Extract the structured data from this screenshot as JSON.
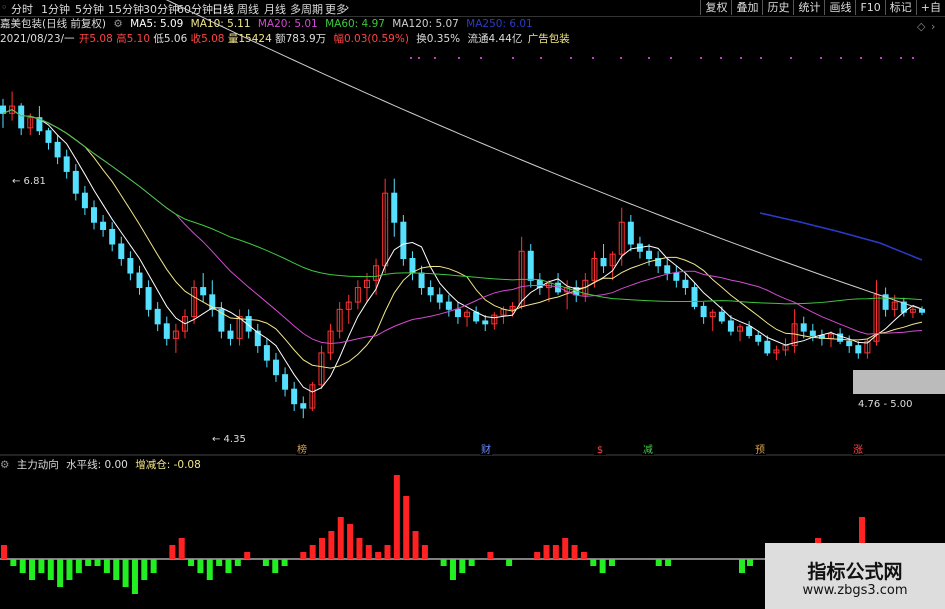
{
  "toolbar": {
    "periods": [
      {
        "label": "分时",
        "x": 11
      },
      {
        "label": "1分钟",
        "x": 41
      },
      {
        "label": "5分钟",
        "x": 75
      },
      {
        "label": "15分钟",
        "x": 108
      },
      {
        "label": "30分钟",
        "x": 143
      },
      {
        "label": "60分钟",
        "x": 177
      },
      {
        "label": "日线",
        "x": 212
      },
      {
        "label": "周线",
        "x": 237
      },
      {
        "label": "月线",
        "x": 264
      },
      {
        "label": "多周期",
        "x": 290
      },
      {
        "label": "更多",
        "x": 325
      }
    ],
    "more_arrow": "›",
    "tools": [
      "复权",
      "叠加",
      "历史",
      "统计",
      "画线",
      "F10",
      "标记",
      "+自"
    ]
  },
  "main_legend": {
    "stock_name": "嘉美包装(日线 前复权)",
    "ma5": "MA5: 5.09",
    "ma10": "MA10: 5.11",
    "ma20": "MA20: 5.01",
    "ma60": "MA60: 4.97",
    "ma120": "MA120: 5.07",
    "ma250": "MA250: 6.01"
  },
  "info_row": {
    "date": "2021/08/23/一",
    "open": "开5.08",
    "high": "高5.10",
    "low": "低5.06",
    "close": "收5.08",
    "volume": "量15424",
    "amount": "额783.9万",
    "change": "幅0.03(0.59%)",
    "turnover": "换0.35%",
    "float": "流通4.44亿",
    "sector": "广告包装"
  },
  "price_labels": {
    "high_mark": "6.81",
    "low_mark": "4.35",
    "range": "4.76 - 5.00"
  },
  "event_markers": [
    {
      "label": "榜",
      "x": 302,
      "color": "#d4a04a"
    },
    {
      "label": "财",
      "x": 486,
      "color": "#6a8cff"
    },
    {
      "label": "$",
      "x": 600,
      "color": "#ff4444"
    },
    {
      "label": "减",
      "x": 648,
      "color": "#44cc44"
    },
    {
      "label": "预",
      "x": 760,
      "color": "#d4a04a"
    },
    {
      "label": "涨",
      "x": 858,
      "color": "#ff4444"
    }
  ],
  "indicator_legend": {
    "name": "主力动向",
    "level": "水平线: 0.00",
    "delta": "增减仓: -0.08"
  },
  "watermark": {
    "title": "指标公式网",
    "url": "www.zbgs3.com"
  },
  "colors": {
    "up": "#ff3333",
    "down": "#55e0ff",
    "ma5": "#ffffff",
    "ma10": "#f2e68a",
    "ma20": "#d24bd2",
    "ma60": "#3fc83f",
    "ma120": "#cfcfcf",
    "ma250": "#2a3cc8",
    "bar_up": "#ff2222",
    "bar_down": "#22ee22"
  },
  "chart_data": {
    "type": "candlestick",
    "ohlc": [
      [
        6.5,
        6.55,
        6.35,
        6.45
      ],
      [
        6.45,
        6.6,
        6.4,
        6.5
      ],
      [
        6.5,
        6.52,
        6.3,
        6.35
      ],
      [
        6.35,
        6.45,
        6.3,
        6.42
      ],
      [
        6.42,
        6.5,
        6.3,
        6.33
      ],
      [
        6.33,
        6.35,
        6.2,
        6.25
      ],
      [
        6.25,
        6.3,
        6.1,
        6.15
      ],
      [
        6.15,
        6.2,
        6.0,
        6.05
      ],
      [
        6.05,
        6.1,
        5.85,
        5.9
      ],
      [
        5.9,
        5.95,
        5.75,
        5.8
      ],
      [
        5.8,
        5.85,
        5.65,
        5.7
      ],
      [
        5.7,
        5.75,
        5.6,
        5.65
      ],
      [
        5.65,
        5.7,
        5.5,
        5.55
      ],
      [
        5.55,
        5.6,
        5.4,
        5.45
      ],
      [
        5.45,
        5.5,
        5.3,
        5.35
      ],
      [
        5.35,
        5.4,
        5.2,
        5.25
      ],
      [
        5.25,
        5.3,
        5.05,
        5.1
      ],
      [
        5.1,
        5.15,
        4.95,
        5.0
      ],
      [
        5.0,
        5.05,
        4.85,
        4.9
      ],
      [
        4.9,
        5.0,
        4.8,
        4.95
      ],
      [
        4.95,
        5.1,
        4.9,
        5.05
      ],
      [
        5.05,
        5.3,
        5.0,
        5.25
      ],
      [
        5.25,
        5.35,
        5.15,
        5.2
      ],
      [
        5.2,
        5.3,
        5.05,
        5.1
      ],
      [
        5.1,
        5.15,
        4.9,
        4.95
      ],
      [
        4.95,
        5.0,
        4.85,
        4.9
      ],
      [
        4.9,
        5.1,
        4.85,
        5.05
      ],
      [
        5.05,
        5.1,
        4.9,
        4.95
      ],
      [
        4.95,
        5.0,
        4.8,
        4.85
      ],
      [
        4.85,
        4.9,
        4.7,
        4.75
      ],
      [
        4.75,
        4.8,
        4.6,
        4.65
      ],
      [
        4.65,
        4.7,
        4.5,
        4.55
      ],
      [
        4.55,
        4.6,
        4.4,
        4.45
      ],
      [
        4.45,
        4.5,
        4.35,
        4.42
      ],
      [
        4.42,
        4.6,
        4.4,
        4.58
      ],
      [
        4.58,
        4.85,
        4.55,
        4.8
      ],
      [
        4.8,
        5.0,
        4.75,
        4.95
      ],
      [
        4.95,
        5.15,
        4.9,
        5.1
      ],
      [
        5.1,
        5.2,
        5.0,
        5.15
      ],
      [
        5.15,
        5.3,
        5.1,
        5.25
      ],
      [
        5.25,
        5.35,
        5.15,
        5.3
      ],
      [
        5.3,
        5.45,
        5.2,
        5.4
      ],
      [
        5.4,
        6.0,
        5.35,
        5.9
      ],
      [
        5.9,
        6.0,
        5.6,
        5.7
      ],
      [
        5.7,
        5.75,
        5.4,
        5.45
      ],
      [
        5.45,
        5.5,
        5.3,
        5.35
      ],
      [
        5.35,
        5.4,
        5.2,
        5.25
      ],
      [
        5.25,
        5.3,
        5.15,
        5.2
      ],
      [
        5.2,
        5.25,
        5.1,
        5.15
      ],
      [
        5.15,
        5.2,
        5.05,
        5.1
      ],
      [
        5.1,
        5.15,
        5.0,
        5.05
      ],
      [
        5.05,
        5.1,
        4.98,
        5.08
      ],
      [
        5.08,
        5.12,
        5.0,
        5.02
      ],
      [
        5.02,
        5.06,
        4.95,
        5.0
      ],
      [
        5.0,
        5.08,
        4.96,
        5.06
      ],
      [
        5.06,
        5.12,
        5.0,
        5.1
      ],
      [
        5.1,
        5.15,
        5.05,
        5.12
      ],
      [
        5.12,
        5.6,
        5.1,
        5.5
      ],
      [
        5.5,
        5.55,
        5.25,
        5.3
      ],
      [
        5.3,
        5.35,
        5.2,
        5.25
      ],
      [
        5.25,
        5.3,
        5.15,
        5.28
      ],
      [
        5.28,
        5.35,
        5.2,
        5.22
      ],
      [
        5.22,
        5.3,
        5.1,
        5.25
      ],
      [
        5.25,
        5.3,
        5.15,
        5.2
      ],
      [
        5.2,
        5.35,
        5.15,
        5.3
      ],
      [
        5.3,
        5.5,
        5.25,
        5.45
      ],
      [
        5.45,
        5.55,
        5.35,
        5.4
      ],
      [
        5.4,
        5.5,
        5.3,
        5.48
      ],
      [
        5.48,
        5.8,
        5.4,
        5.7
      ],
      [
        5.7,
        5.75,
        5.5,
        5.55
      ],
      [
        5.55,
        5.6,
        5.45,
        5.5
      ],
      [
        5.5,
        5.55,
        5.4,
        5.45
      ],
      [
        5.45,
        5.5,
        5.35,
        5.4
      ],
      [
        5.4,
        5.45,
        5.3,
        5.35
      ],
      [
        5.35,
        5.4,
        5.25,
        5.3
      ],
      [
        5.3,
        5.35,
        5.2,
        5.25
      ],
      [
        5.25,
        5.28,
        5.1,
        5.12
      ],
      [
        5.12,
        5.15,
        5.0,
        5.05
      ],
      [
        5.05,
        5.1,
        4.95,
        5.08
      ],
      [
        5.08,
        5.12,
        5.0,
        5.02
      ],
      [
        5.02,
        5.06,
        4.92,
        4.95
      ],
      [
        4.95,
        5.0,
        4.88,
        4.98
      ],
      [
        4.98,
        5.02,
        4.9,
        4.92
      ],
      [
        4.92,
        4.95,
        4.85,
        4.88
      ],
      [
        4.88,
        4.92,
        4.78,
        4.8
      ],
      [
        4.8,
        4.85,
        4.75,
        4.82
      ],
      [
        4.82,
        4.9,
        4.78,
        4.85
      ],
      [
        4.85,
        5.1,
        4.8,
        5.0
      ],
      [
        5.0,
        5.05,
        4.9,
        4.95
      ],
      [
        4.95,
        5.0,
        4.88,
        4.92
      ],
      [
        4.92,
        4.96,
        4.85,
        4.9
      ],
      [
        4.9,
        4.95,
        4.84,
        4.93
      ],
      [
        4.93,
        4.97,
        4.86,
        4.88
      ],
      [
        4.88,
        4.92,
        4.8,
        4.85
      ],
      [
        4.85,
        4.88,
        4.76,
        4.8
      ],
      [
        4.8,
        4.9,
        4.76,
        4.88
      ],
      [
        4.88,
        5.3,
        4.85,
        5.2
      ],
      [
        5.2,
        5.25,
        5.05,
        5.1
      ],
      [
        5.1,
        5.2,
        5.05,
        5.15
      ],
      [
        5.15,
        5.18,
        5.05,
        5.08
      ],
      [
        5.08,
        5.12,
        5.04,
        5.1
      ],
      [
        5.1,
        5.12,
        5.06,
        5.08
      ]
    ],
    "indicator_bars": [
      2,
      -1,
      -2,
      -3,
      -2,
      -3,
      -4,
      -3,
      -2,
      -1,
      -1,
      -2,
      -3,
      -4,
      -5,
      -3,
      -2,
      0,
      2,
      3,
      -1,
      -2,
      -3,
      -1,
      -2,
      -1,
      1,
      0,
      -1,
      -2,
      -1,
      0,
      1,
      2,
      3,
      4,
      6,
      5,
      3,
      2,
      1,
      2,
      12,
      9,
      4,
      2,
      0,
      -1,
      -3,
      -2,
      -1,
      0,
      1,
      0,
      -1,
      0,
      0,
      1,
      2,
      2,
      3,
      2,
      1,
      -1,
      -2,
      -1,
      0,
      0,
      0,
      0,
      -1,
      -1,
      0,
      0,
      0,
      0,
      0,
      0,
      0,
      0,
      0,
      0,
      0,
      0,
      0,
      0,
      0,
      0,
      0,
      0,
      0,
      0,
      0,
      0,
      0,
      0,
      0,
      0,
      0,
      0
    ],
    "ylim": [
      4.2,
      6.9
    ]
  }
}
